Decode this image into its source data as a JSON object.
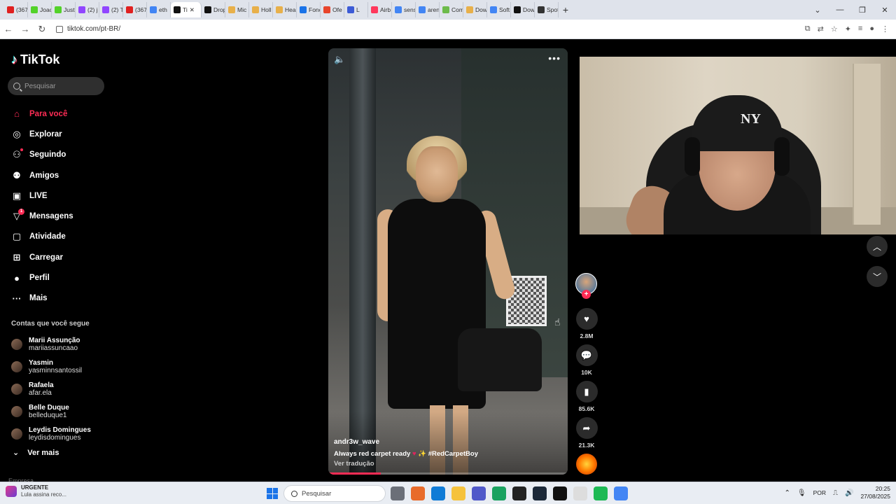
{
  "browser": {
    "tabs": [
      {
        "label": "(367",
        "color": "#e02020"
      },
      {
        "label": "Joac",
        "color": "#53d22a"
      },
      {
        "label": "Just",
        "color": "#53d22a"
      },
      {
        "label": "(2) j",
        "color": "#9146ff"
      },
      {
        "label": "(2) T",
        "color": "#9146ff"
      },
      {
        "label": "(367",
        "color": "#e02020"
      },
      {
        "label": "eth",
        "color": "#4285f4"
      },
      {
        "label": "Ti",
        "color": "#111111",
        "active": true
      },
      {
        "label": "Drop",
        "color": "#111111"
      },
      {
        "label": "Mic",
        "color": "#e8b04a"
      },
      {
        "label": "Holl",
        "color": "#e8b04a"
      },
      {
        "label": "Hea",
        "color": "#e8b04a"
      },
      {
        "label": "Fonc",
        "color": "#1a73e8"
      },
      {
        "label": "Ofe",
        "color": "#e8452c"
      },
      {
        "label": "L",
        "color": "#3c5bd6"
      },
      {
        "label": "Airb",
        "color": "#ff385c"
      },
      {
        "label": "sens",
        "color": "#4285f4"
      },
      {
        "label": "aren",
        "color": "#4285f4"
      },
      {
        "label": "Com",
        "color": "#6dbb4b"
      },
      {
        "label": "Dow",
        "color": "#e8b04a"
      },
      {
        "label": "Soft",
        "color": "#4285f4"
      },
      {
        "label": "Dow",
        "color": "#111111"
      },
      {
        "label": "Spot",
        "color": "#333333"
      }
    ],
    "new_tab": "+",
    "url": "tiktok.com/pt-BR/"
  },
  "tiktok": {
    "logo": "TikTok",
    "search_placeholder": "Pesquisar",
    "menu": [
      {
        "label": "Para você",
        "icon": "home-icon",
        "glyph": "⌂",
        "active": true
      },
      {
        "label": "Explorar",
        "icon": "compass-icon",
        "glyph": "◎"
      },
      {
        "label": "Seguindo",
        "icon": "following-icon",
        "glyph": "⚇",
        "dot": true
      },
      {
        "label": "Amigos",
        "icon": "friends-icon",
        "glyph": "⚉"
      },
      {
        "label": "LIVE",
        "icon": "live-icon",
        "glyph": "▣"
      },
      {
        "label": "Mensagens",
        "icon": "messages-icon",
        "glyph": "▽",
        "badge": "1"
      },
      {
        "label": "Atividade",
        "icon": "activity-icon",
        "glyph": "▢"
      },
      {
        "label": "Carregar",
        "icon": "upload-icon",
        "glyph": "⊞"
      },
      {
        "label": "Perfil",
        "icon": "profile-icon",
        "glyph": "●"
      },
      {
        "label": "Mais",
        "icon": "more-icon",
        "glyph": "···"
      }
    ],
    "following_title": "Contas que você segue",
    "following": [
      {
        "name": "Marii Assunção",
        "user": "mariiassuncaao"
      },
      {
        "name": "Yasmin",
        "user": "yasminnsantossil"
      },
      {
        "name": "Rafaela",
        "user": "afar.ela"
      },
      {
        "name": "Belle Duque",
        "user": "belleduque1"
      },
      {
        "name": "Leydis Domingues",
        "user": "leydisdomingues"
      }
    ],
    "ver_mais": "Ver mais",
    "empresa": "Empresa"
  },
  "video": {
    "username": "andr3w_wave",
    "description": "Always red carpet ready",
    "sparkle": "✨",
    "hashtag": "#RedCarpetBoy",
    "translate": "Ver tradução",
    "progress": 0.22,
    "likes": "2.8M",
    "comments": "10K",
    "saves": "85.6K",
    "shares": "21.3K",
    "follow_plus": "+"
  },
  "webcam": {
    "cap_logo": "NY"
  },
  "taskbar": {
    "news_title": "URGENTE",
    "news_sub": "Lula assina reco...",
    "search": "Pesquisar",
    "apps": [
      "#6b6f78",
      "#e86b2a",
      "#0f7bd6",
      "#f5c23c",
      "#5059c9",
      "#1aa260",
      "#222222",
      "#1b2838",
      "#111111",
      "#dddddd",
      "#1db954",
      "#4285f4"
    ],
    "lang": "POR",
    "time": "20:25",
    "date": "27/08/2025"
  }
}
